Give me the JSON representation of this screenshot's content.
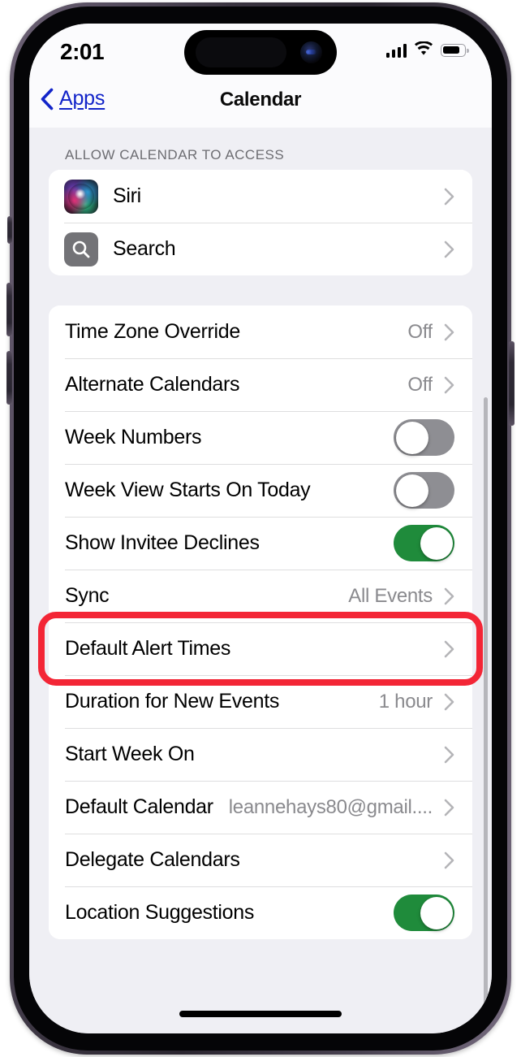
{
  "status_bar": {
    "time": "2:01",
    "signal_icon": "cellular-signal-icon",
    "wifi_icon": "wifi-icon",
    "battery_icon": "battery-icon",
    "battery_level_percent": 80
  },
  "nav_bar": {
    "back_label": "Apps",
    "back_icon": "chevron-left-icon",
    "title": "Calendar"
  },
  "sections": [
    {
      "header": "ALLOW CALENDAR TO ACCESS",
      "rows": [
        {
          "label": "Siri",
          "icon": "siri-icon",
          "accessory": "chevron"
        },
        {
          "label": "Search",
          "icon": "search-icon",
          "accessory": "chevron"
        }
      ]
    },
    {
      "header": "",
      "rows": [
        {
          "label": "Time Zone Override",
          "value": "Off",
          "accessory": "chevron"
        },
        {
          "label": "Alternate Calendars",
          "value": "Off",
          "accessory": "chevron"
        },
        {
          "label": "Week Numbers",
          "accessory": "toggle",
          "toggle": "off"
        },
        {
          "label": "Week View Starts On Today",
          "accessory": "toggle",
          "toggle": "off"
        },
        {
          "label": "Show Invitee Declines",
          "accessory": "toggle",
          "toggle": "on"
        },
        {
          "label": "Sync",
          "value": "All Events",
          "accessory": "chevron"
        },
        {
          "label": "Default Alert Times",
          "value": "",
          "accessory": "chevron",
          "highlighted": true
        },
        {
          "label": "Duration for New Events",
          "value": "1 hour",
          "accessory": "chevron"
        },
        {
          "label": "Start Week On",
          "value": "",
          "accessory": "chevron"
        },
        {
          "label": "Default Calendar",
          "value": "leannehays80@gmail....",
          "accessory": "chevron"
        },
        {
          "label": "Delegate Calendars",
          "value": "",
          "accessory": "chevron"
        },
        {
          "label": "Location Suggestions",
          "accessory": "toggle",
          "toggle": "on"
        }
      ]
    }
  ],
  "annotation": {
    "type": "red-rounded-rectangle",
    "color": "#f32636",
    "targets_row_label": "Default Alert Times"
  },
  "colors": {
    "link": "#1224c9",
    "toggle_on": "#1f8b3b",
    "toggle_off": "#8e8e93",
    "value_text": "#8a8a8e",
    "background": "#efeff4",
    "card": "#ffffff"
  }
}
